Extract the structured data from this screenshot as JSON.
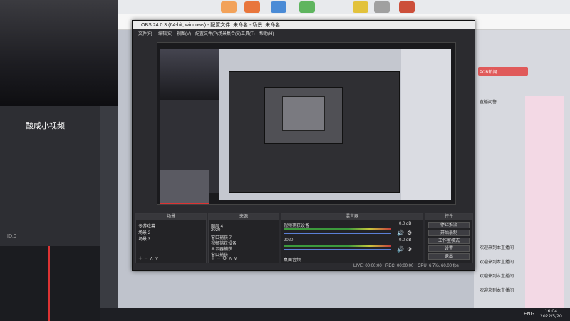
{
  "stream": {
    "brand": "酸咸小视频",
    "channel_id": "ID:0"
  },
  "obs": {
    "title": "OBS 24.0.3 (64-bit, windows) - 配置文件: 未命名 - 场景: 未命名",
    "menu": [
      "文件(F)",
      "编辑(E)",
      "视图(V)",
      "配置文件(P)",
      "场景集合(S)",
      "工具(T)",
      "帮助(H)"
    ],
    "docks": {
      "scenes": {
        "title": "场景",
        "items": [
          "多游戏幕",
          "场景 2",
          "场景 3"
        ]
      },
      "sources": {
        "title": "来源",
        "items": [
          "图层 4",
          "2020",
          "窗口捕获 7",
          "视频捕获设备",
          "显示器捕获",
          "窗口捕获"
        ]
      },
      "mixer": {
        "title": "混音器",
        "channels": [
          {
            "name": "视频捕获设备",
            "level": "0.0 dB",
            "volume": 0.95
          },
          {
            "name": "2020",
            "level": "0.0 dB",
            "volume": 0.95
          },
          {
            "name": "桌面音频",
            "level": "",
            "volume": 0
          }
        ]
      },
      "controls": {
        "title": "控件",
        "buttons": [
          "停止推流",
          "开始录制",
          "工作室模式",
          "设置",
          "退出"
        ]
      }
    },
    "bottom_buttons": [
      "转场",
      "场景转场"
    ],
    "status": {
      "live": "LIVE: 00:00:00",
      "rec": "REC: 00:00:00",
      "cpu": "CPU: 6.7%, 60.00 fps"
    }
  },
  "taskbar": {
    "lang": "ENG",
    "time": "16:04",
    "date": "2022/5/20"
  },
  "right_panel": {
    "badge": "PCB新闻",
    "items": [
      "直播问答：",
      "欢迎来到本直播间",
      "欢迎来到本直播间",
      "欢迎来到本直播间",
      "欢迎来到本直播间"
    ]
  },
  "colors": {
    "obs_bg": "#2b2b2f",
    "accent_red": "#d33"
  }
}
